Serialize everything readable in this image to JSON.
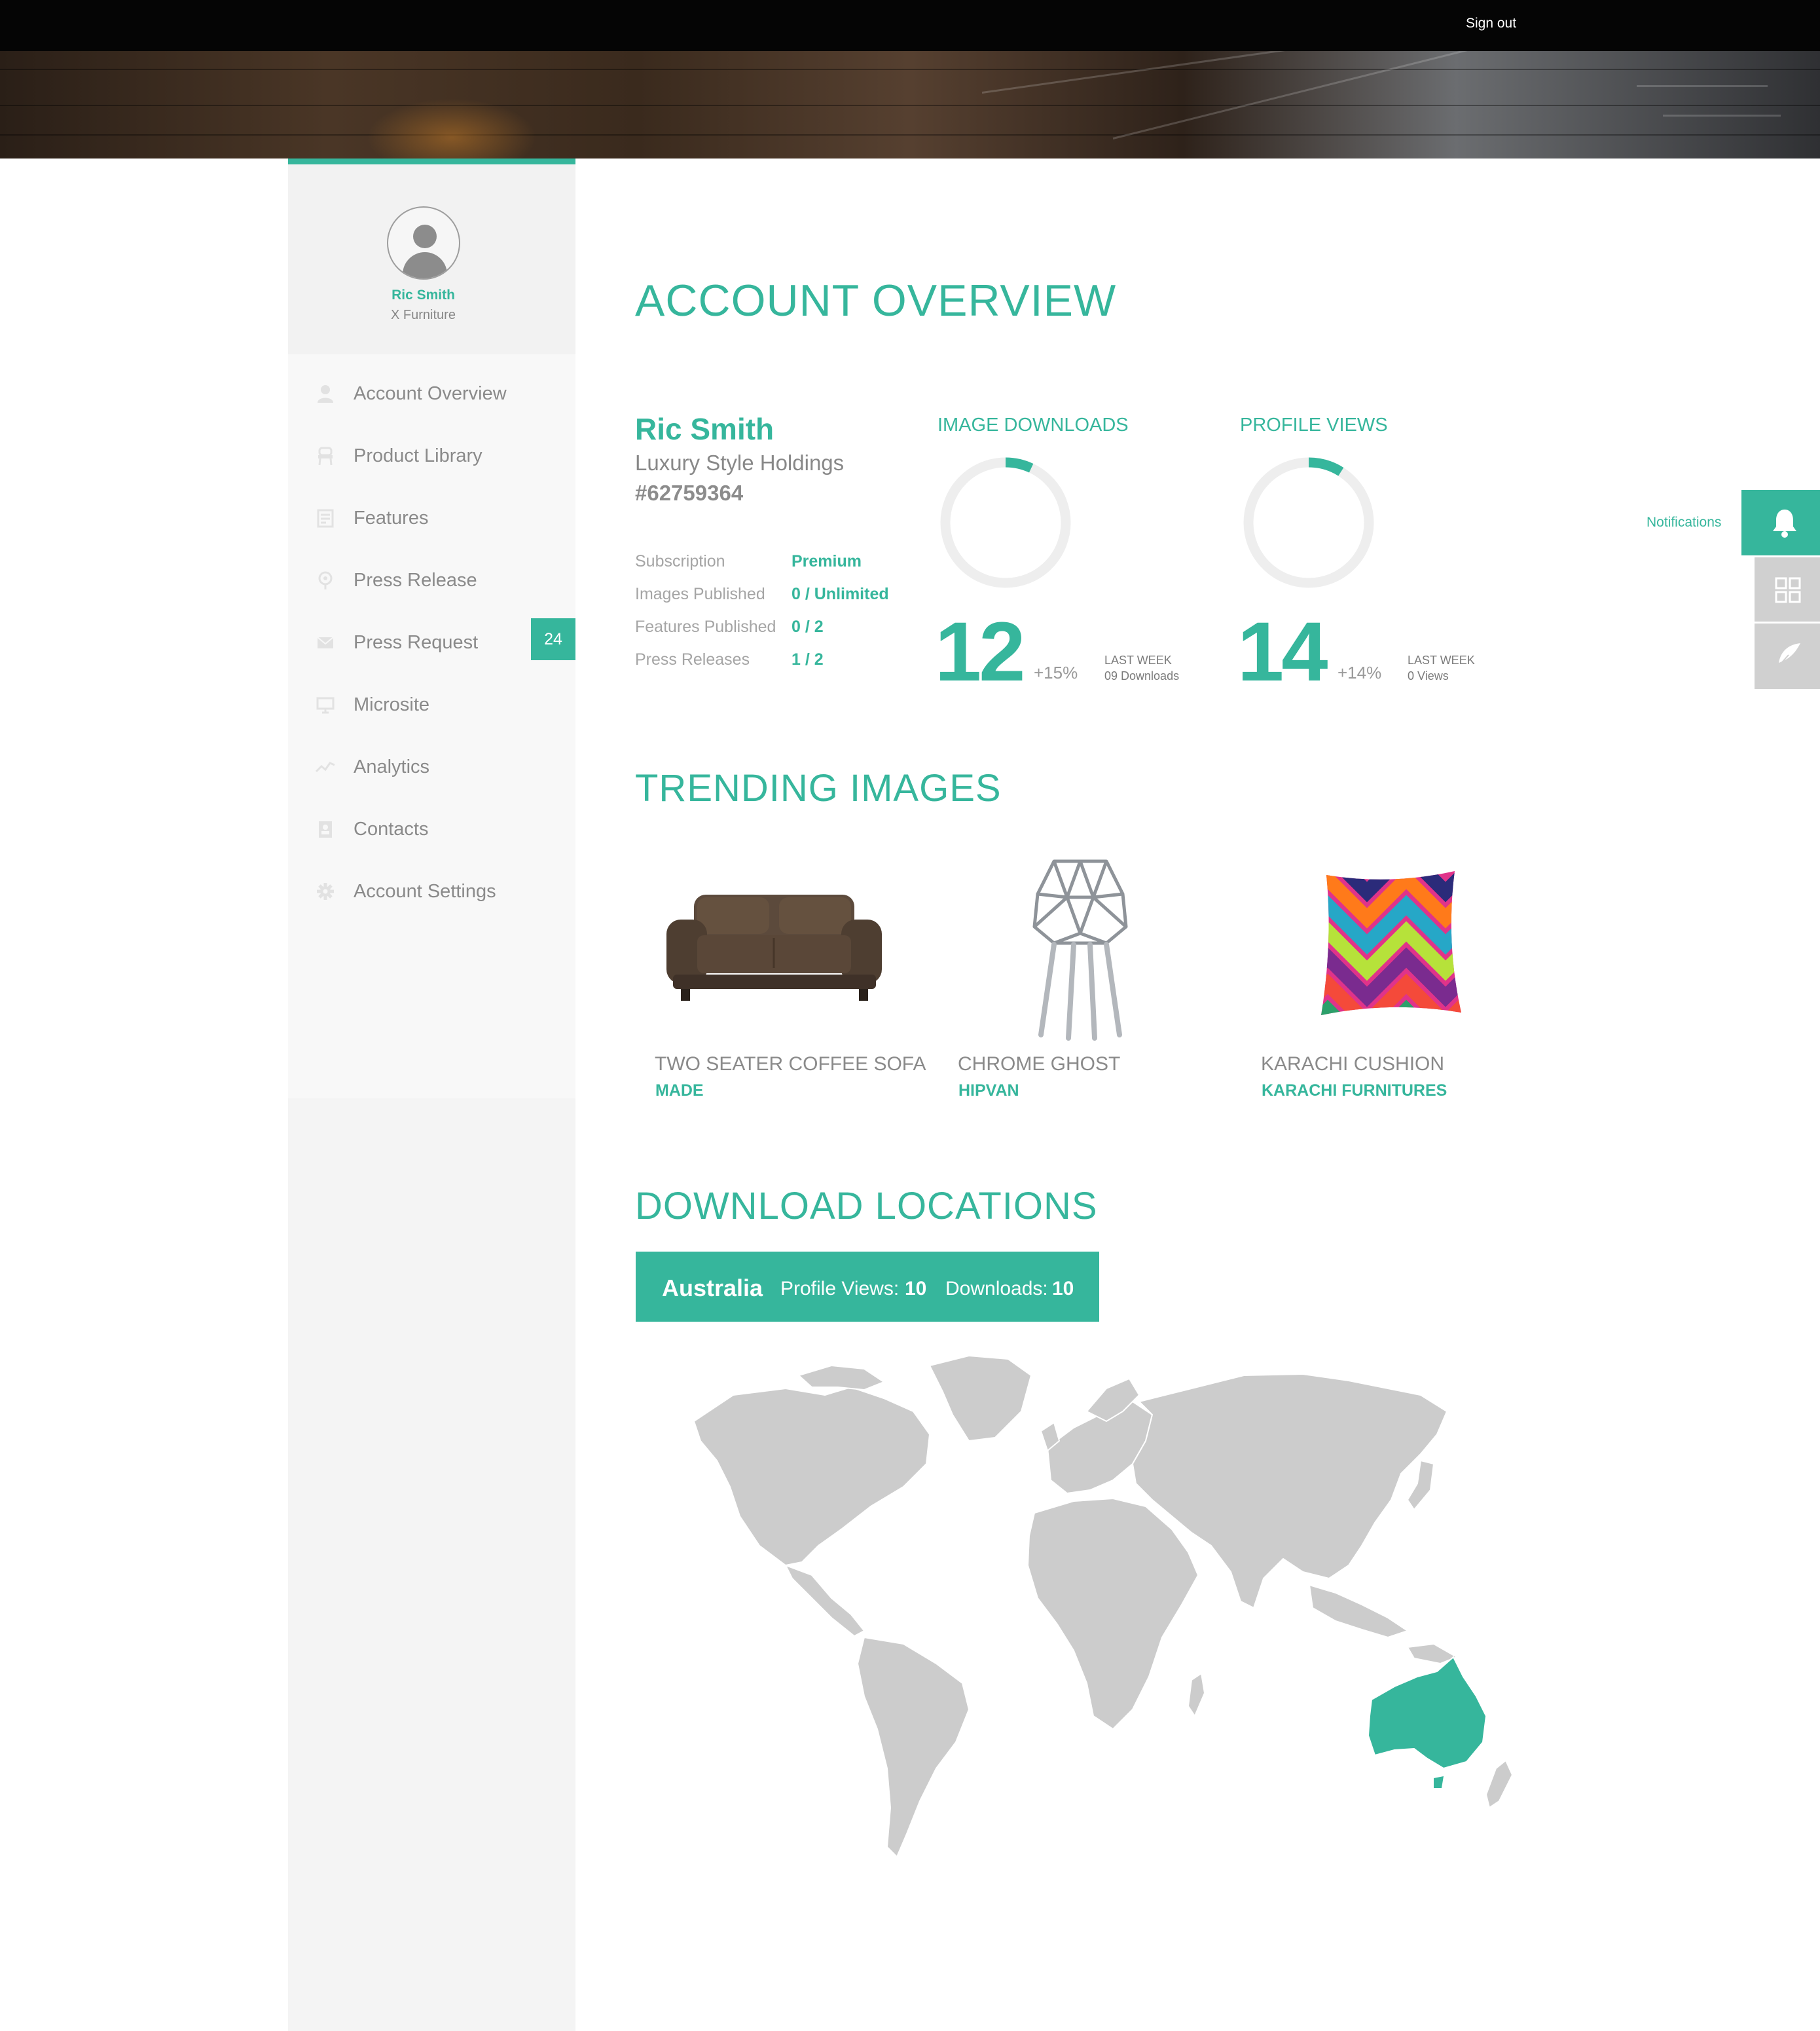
{
  "header": {
    "signout_label": "Sign out"
  },
  "profile": {
    "name": "Ric Smith",
    "company": "X Furniture"
  },
  "sidebar": {
    "items": [
      {
        "label": "Account Overview",
        "icon": "user-icon"
      },
      {
        "label": "Product Library",
        "icon": "chair-icon"
      },
      {
        "label": "Features",
        "icon": "features-icon"
      },
      {
        "label": "Press Release",
        "icon": "microphone-icon"
      },
      {
        "label": "Press Request",
        "icon": "envelope-icon",
        "badge": "24"
      },
      {
        "label": "Microsite",
        "icon": "monitor-icon"
      },
      {
        "label": "Analytics",
        "icon": "trend-line-icon"
      },
      {
        "label": "Contacts",
        "icon": "address-book-icon"
      },
      {
        "label": "Account Settings",
        "icon": "gear-icon"
      }
    ]
  },
  "overview": {
    "title": "ACCOUNT OVERVIEW",
    "account": {
      "name": "Ric Smith",
      "company": "Luxury Style Holdings",
      "id": "#62759364",
      "stats": [
        {
          "label": "Subscription",
          "value": "Premium"
        },
        {
          "label": "Images Published",
          "value": "0 / Unlimited"
        },
        {
          "label": "Features Published",
          "value": "0 / 2"
        },
        {
          "label": "Press Releases",
          "value": "1 / 2"
        }
      ]
    },
    "metrics": [
      {
        "title": "IMAGE DOWNLOADS",
        "value": "12",
        "change": "+15%",
        "last_week_label": "LAST WEEK",
        "last_week_value": "09 Downloads",
        "progress": 0.07
      },
      {
        "title": "PROFILE VIEWS",
        "value": "14",
        "change": "+14%",
        "last_week_label": "LAST WEEK",
        "last_week_value": "0 Views",
        "progress": 0.09
      }
    ]
  },
  "trending": {
    "title": "TRENDING IMAGES",
    "items": [
      {
        "name": "TWO SEATER COFFEE SOFA",
        "brand": "MADE",
        "image": "sofa-image"
      },
      {
        "name": "CHROME GHOST",
        "brand": "HIPVAN",
        "image": "chair-image"
      },
      {
        "name": "KARACHI CUSHION",
        "brand": "KARACHI FURNITURES",
        "image": "cushion-image"
      }
    ]
  },
  "locations": {
    "title": "DOWNLOAD LOCATIONS",
    "selected": {
      "country": "Australia",
      "views_label": "Profile Views:",
      "views_value": "10",
      "downloads_label": "Downloads:",
      "downloads_value": "10"
    },
    "highlight_color": "#36b69c",
    "land_color": "#cccccc"
  },
  "dock": {
    "notifications_label": "Notifications"
  },
  "colors": {
    "accent": "#36b69c",
    "sidebar_bg": "#f4f4f4",
    "topbar": "#050505"
  }
}
